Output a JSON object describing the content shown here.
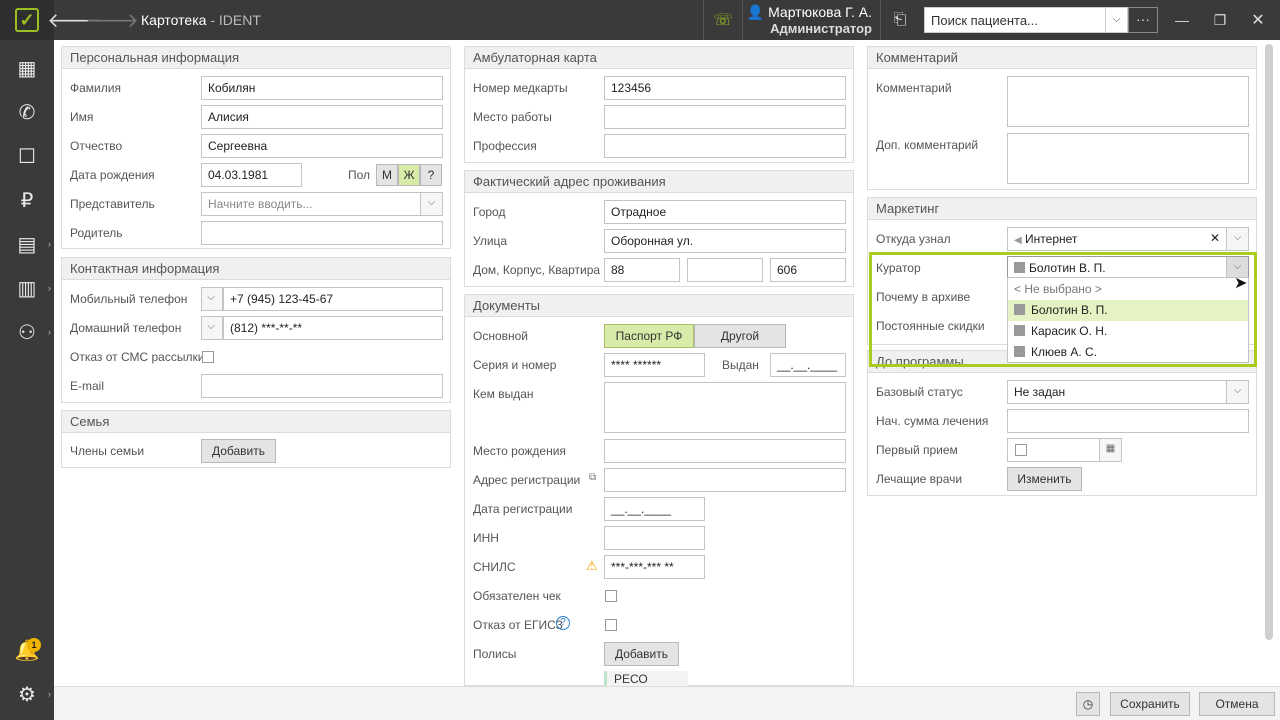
{
  "topbar": {
    "title": "Картотека",
    "app": "IDENT",
    "user_name": "Мартюкова Г. А.",
    "user_role": "Администратор",
    "search_placeholder": "Поиск пациента...",
    "more": "···"
  },
  "sidebar": {
    "notification_count": "1"
  },
  "personal": {
    "header": "Персональная информация",
    "surname_label": "Фамилия",
    "surname": "Кобилян",
    "name_label": "Имя",
    "name": "Алисия",
    "patronymic_label": "Отчество",
    "patronymic": "Сергеевна",
    "dob_label": "Дата рождения",
    "dob": "04.03.1981",
    "gender_label": "Пол",
    "gender_m": "М",
    "gender_f": "Ж",
    "gender_unknown": "?",
    "representative_label": "Представитель",
    "representative_placeholder": "Начните вводить...",
    "parent_label": "Родитель"
  },
  "contact": {
    "header": "Контактная информация",
    "mobile_label": "Мобильный телефон",
    "mobile": "+7 (945) 123-45-67",
    "home_label": "Домашний телефон",
    "home": "(812) ***-**-**",
    "sms_label": "Отказ от СМС рассылки",
    "email_label": "E-mail"
  },
  "family": {
    "header": "Семья",
    "members_label": "Члены семьи",
    "add_button": "Добавить"
  },
  "ambulatory": {
    "header": "Амбулаторная карта",
    "card_label": "Номер медкарты",
    "card": "123456",
    "work_label": "Место работы",
    "profession_label": "Профессия"
  },
  "address": {
    "header": "Фактический адрес проживания",
    "city_label": "Город",
    "city": "Отрадное",
    "street_label": "Улица",
    "street": "Оборонная ул.",
    "house_label": "Дом, Корпус, Квартира",
    "house": "88",
    "building": "",
    "apartment": "606"
  },
  "documents": {
    "header": "Документы",
    "main_label": "Основной",
    "tab_passport": "Паспорт РФ",
    "tab_other": "Другой",
    "series_label": "Серия и номер",
    "series": "**** ******",
    "issued_label": "Выдан",
    "issued": "__.__.____",
    "issued_by_label": "Кем выдан",
    "birthplace_label": "Место рождения",
    "reg_address_label": "Адрес регистрации",
    "reg_date_label": "Дата регистрации",
    "reg_date": "__.__.____",
    "inn_label": "ИНН",
    "snils_label": "СНИЛС",
    "snils": "***-***-*** **",
    "check_label": "Обязателен чек",
    "egisz_label": "Отказ от ЕГИСЗ",
    "policies_label": "Полисы",
    "policies_add": "Добавить",
    "policy_item": "РЕСО"
  },
  "comment": {
    "header": "Комментарий",
    "comment_label": "Комментарий",
    "extra_label": "Доп. комментарий"
  },
  "marketing": {
    "header": "Маркетинг",
    "source_label": "Откуда узнал",
    "source": "Интернет",
    "curator_label": "Куратор",
    "curator": "Болотин В. П.",
    "archive_label": "Почему в архиве",
    "discounts_label": "Постоянные скидки",
    "options": [
      "< Не выбрано >",
      "Болотин В. П.",
      "Карасик О. Н.",
      "Клюев А. С."
    ]
  },
  "program": {
    "header": "До программы",
    "status_label": "Базовый статус",
    "status": "Не задан",
    "sum_label": "Нач. сумма лечения",
    "first_visit_label": "Первый прием",
    "doctors_label": "Лечащие врачи",
    "doctors_button": "Изменить"
  },
  "footer": {
    "save": "Сохранить",
    "cancel": "Отмена"
  }
}
